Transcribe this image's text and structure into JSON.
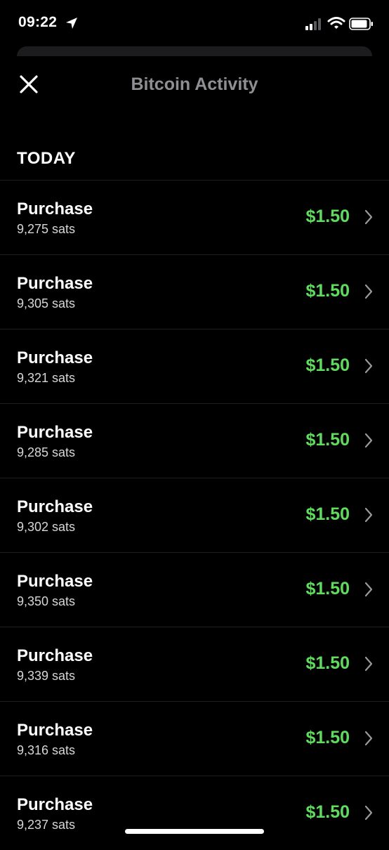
{
  "status_bar": {
    "time": "09:22"
  },
  "header": {
    "title": "Bitcoin Activity"
  },
  "section": {
    "label": "TODAY"
  },
  "transactions": [
    {
      "title": "Purchase",
      "sats": "9,275 sats",
      "amount": "$1.50"
    },
    {
      "title": "Purchase",
      "sats": "9,305 sats",
      "amount": "$1.50"
    },
    {
      "title": "Purchase",
      "sats": "9,321 sats",
      "amount": "$1.50"
    },
    {
      "title": "Purchase",
      "sats": "9,285 sats",
      "amount": "$1.50"
    },
    {
      "title": "Purchase",
      "sats": "9,302 sats",
      "amount": "$1.50"
    },
    {
      "title": "Purchase",
      "sats": "9,350 sats",
      "amount": "$1.50"
    },
    {
      "title": "Purchase",
      "sats": "9,339 sats",
      "amount": "$1.50"
    },
    {
      "title": "Purchase",
      "sats": "9,316 sats",
      "amount": "$1.50"
    },
    {
      "title": "Purchase",
      "sats": "9,237 sats",
      "amount": "$1.50"
    }
  ],
  "icons": {
    "close": "close-icon",
    "row_chevron": "chevron-right-icon",
    "location": "location-arrow-icon",
    "signal": "cellular-signal-icon",
    "wifi": "wifi-icon",
    "battery": "battery-icon"
  },
  "colors": {
    "background": "#000000",
    "amount_green": "#5fdc5e",
    "title_gray": "#8e8e93",
    "divider": "#1f1f21"
  }
}
